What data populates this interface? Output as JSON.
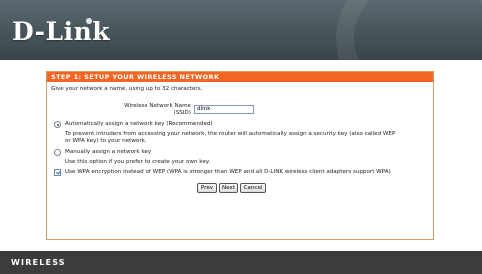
{
  "header": {
    "brand": "D-Link"
  },
  "setup": {
    "title": "STEP 1: SETUP YOUR WIRELESS NETWORK",
    "intro": "Give your network a name, using up to 32 characters.",
    "network_name_label_line1": "Wireless Network Name",
    "network_name_label_line2": "(SSID)",
    "network_name_value": "dlink",
    "auto_key_label": "Automatically assign a network key (Recommended)",
    "auto_key_desc_line1": "To prevent intruders from accessing your network, the router will automatically assign a security key (also called WEP",
    "auto_key_desc_line2": "or WPA key) to your network.",
    "manual_key_label": "Manually assign a network key",
    "manual_key_desc": "Use this option if you prefer to create your own key.",
    "wpa_label": "Use WPA encryption instead of WEP (WPA is stronger than WEP and all D-LINK wireless client adapters support WPA)",
    "buttons": {
      "prev": "Prev",
      "next": "Next",
      "cancel": "Cancel"
    }
  },
  "footer": {
    "label": "WIRELESS"
  },
  "colors": {
    "accent": "#f26522",
    "header_bg": "#47555b",
    "footer_bg": "#3a3c3e"
  },
  "icons": [
    "radio-selected-icon",
    "radio-unselected-icon",
    "checkbox-checked-icon"
  ]
}
